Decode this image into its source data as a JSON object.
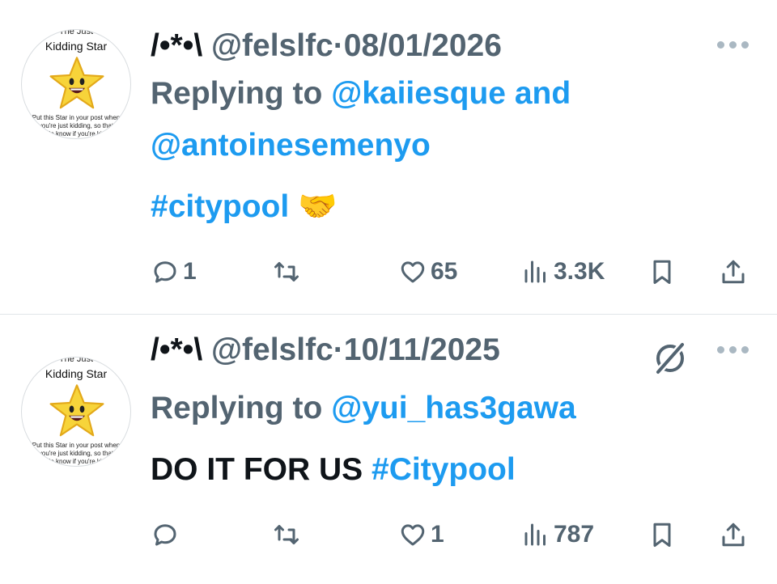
{
  "tweets": [
    {
      "avatar": {
        "caption_top": "The Just",
        "caption_title": "Kidding Star",
        "caption_small": [
          "Put this Star in your post when",
          "you're just kidding, so that",
          "people know if you're kidding"
        ]
      },
      "display_name": "/•*•\\",
      "handle": "@felslfc",
      "separator": "·",
      "date": "08/01/2026",
      "replying_prefix": "Replying to",
      "mention_1": "@kaiiesque",
      "joiner": "and",
      "mention_2": "@antoinesemenyo",
      "body_plain": "",
      "hashtag": "#citypool",
      "emoji": "🤝",
      "actions": {
        "replies": "1",
        "retweets": "",
        "likes": "65",
        "views": "3.3K"
      }
    },
    {
      "avatar": {
        "caption_top": "The Just",
        "caption_title": "Kidding Star",
        "caption_small": [
          "Put this Star in your post when",
          "you're just kidding, so that",
          "people know if you're kidding"
        ]
      },
      "display_name": "/•*•\\",
      "handle": "@felslfc",
      "separator": "·",
      "date": "10/11/2025",
      "replying_prefix": "Replying to",
      "mention_1": "@yui_has3gawa",
      "body_plain": "DO IT FOR US",
      "hashtag": "#Citypool",
      "actions": {
        "replies": "",
        "retweets": "",
        "likes": "1",
        "views": "787"
      }
    }
  ],
  "colors": {
    "accent": "#1d9bf0",
    "muted": "#536471",
    "text": "#0f1419",
    "divider": "#e1e5e8"
  },
  "icons": [
    "reply-icon",
    "retweet-icon",
    "like-icon",
    "views-icon",
    "bookmark-icon",
    "share-icon",
    "more-icon",
    "no-circle-icon"
  ]
}
